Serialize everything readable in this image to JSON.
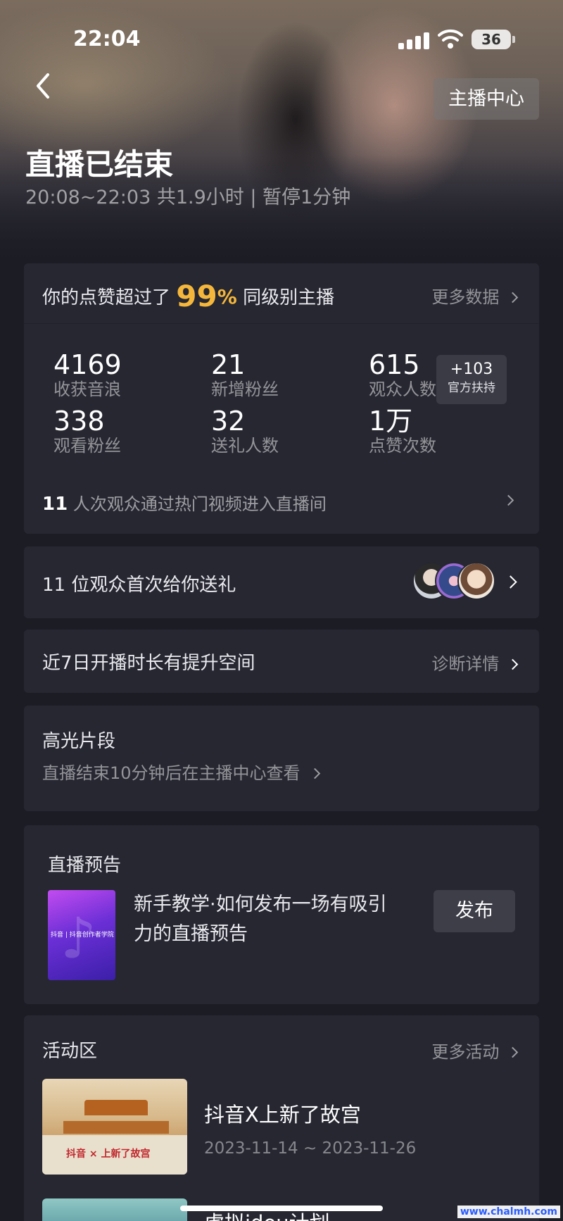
{
  "status_bar": {
    "time": "22:04",
    "battery": "36"
  },
  "header": {
    "host_center": "主播中心",
    "title": "直播已结束",
    "subtitle": "20:08~22:03 共1.9小时 | 暂停1分钟"
  },
  "summary": {
    "beat_prefix": "你的点赞超过了",
    "beat_percent": "99",
    "beat_percent_sign": "%",
    "beat_suffix": "同级别主播",
    "more_data": "更多数据",
    "stats": [
      {
        "value": "4169",
        "label": "收获音浪"
      },
      {
        "value": "21",
        "label": "新增粉丝"
      },
      {
        "value": "615",
        "label": "观众人数"
      },
      {
        "value": "338",
        "label": "观看粉丝"
      },
      {
        "value": "32",
        "label": "送礼人数"
      },
      {
        "value": "1万",
        "label": "点赞次数"
      }
    ],
    "badge": {
      "value": "+103",
      "label": "官方扶持"
    },
    "hot_count": "11",
    "hot_text": "人次观众通过热门视频进入直播间"
  },
  "first_gift": {
    "text": "11 位观众首次给你送礼"
  },
  "improve": {
    "text": "近7日开播时长有提升空间",
    "link": "诊断详情"
  },
  "highlights": {
    "title": "高光片段",
    "desc": "直播结束10分钟后在主播中心查看"
  },
  "preview": {
    "title": "直播预告",
    "item_title": "新手教学·如何发布一场有吸引力的直播预告",
    "thumb_tag": "抖音 | 抖音创作者学院",
    "button": "发布"
  },
  "activities": {
    "title": "活动区",
    "more": "更多活动",
    "items": [
      {
        "title": "抖音X上新了故宫",
        "date": "2023-11-14 ~ 2023-11-26",
        "thumb_text": "抖音 × 上新了故宫"
      },
      {
        "title": "虚拟idou计划"
      }
    ]
  },
  "watermark": "www.chalmh.com"
}
